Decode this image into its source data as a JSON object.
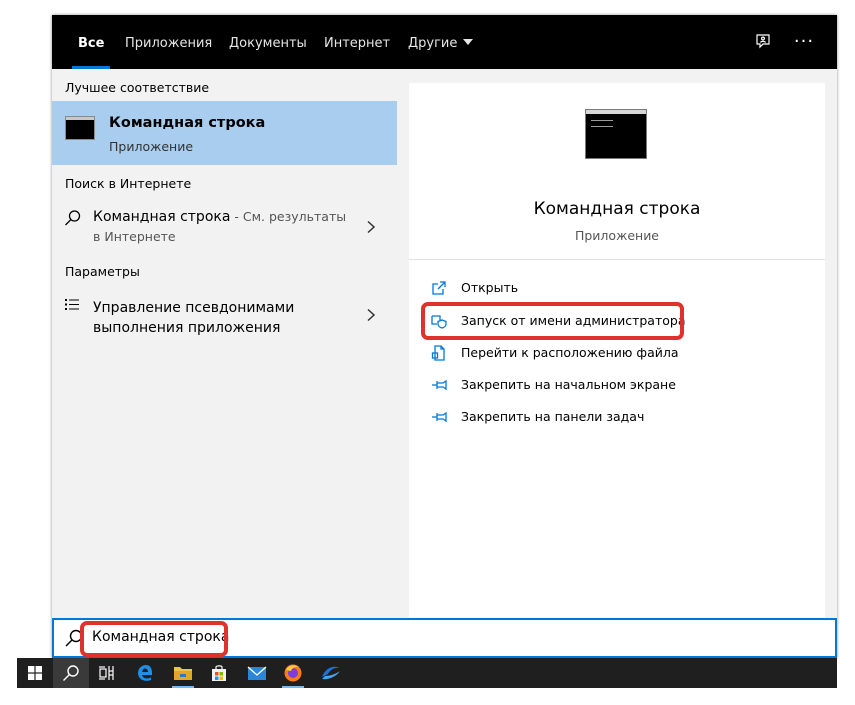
{
  "tabs": [
    {
      "label": "Все",
      "active": true
    },
    {
      "label": "Приложения"
    },
    {
      "label": "Документы"
    },
    {
      "label": "Интернет"
    },
    {
      "label": "Другие",
      "has_dropdown": true
    }
  ],
  "top_icons": [
    "feedback-icon",
    "more-options-icon"
  ],
  "top_more_label": "···",
  "left": {
    "best_match_label": "Лучшее соответствие",
    "best_match": {
      "title": "Командная строка",
      "subtitle": "Приложение",
      "icon": "command-prompt-icon"
    },
    "web_label": "Поиск в Интернете",
    "web_result": {
      "title": "Командная строка",
      "suffix": " - См. результаты в Интернете",
      "icon": "search-icon"
    },
    "settings_label": "Параметры",
    "settings_result": {
      "title": "Управление псевдонимами выполнения приложения",
      "icon": "list-icon"
    }
  },
  "preview": {
    "title": "Командная строка",
    "subtitle": "Приложение",
    "icon": "command-prompt-icon",
    "actions": [
      {
        "label": "Открыть",
        "icon": "open-icon"
      },
      {
        "label": "Запуск от имени администратора",
        "icon": "shield-icon",
        "highlighted": true
      },
      {
        "label": "Перейти к расположению файла",
        "icon": "file-location-icon"
      },
      {
        "label": "Закрепить на начальном экране",
        "icon": "pin-icon"
      },
      {
        "label": "Закрепить на панели задач",
        "icon": "pin-icon"
      }
    ]
  },
  "search": {
    "value": "Командная строка",
    "icon": "search-icon"
  },
  "taskbar": [
    {
      "name": "windows-start-icon"
    },
    {
      "name": "search-icon",
      "active": true
    },
    {
      "name": "task-view-icon"
    },
    {
      "name": "edge-icon"
    },
    {
      "name": "file-explorer-icon",
      "open": true
    },
    {
      "name": "store-icon"
    },
    {
      "name": "mail-icon"
    },
    {
      "name": "firefox-icon",
      "open": true
    },
    {
      "name": "app-icon"
    }
  ],
  "colors": {
    "accent": "#0078d7",
    "selection": "#a8cdee",
    "highlight": "#e0322c",
    "topbar": "#000000",
    "taskbar": "#1f1f1f"
  }
}
